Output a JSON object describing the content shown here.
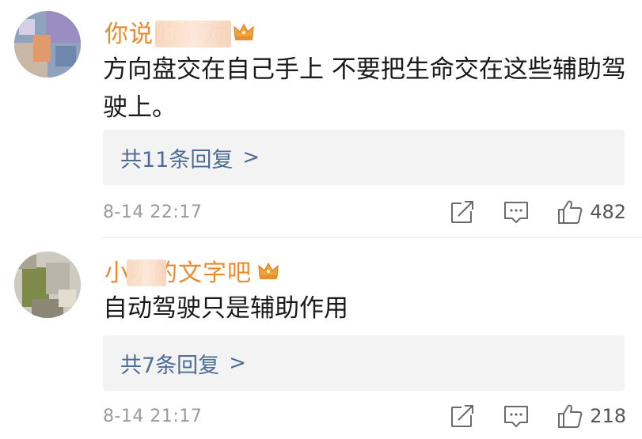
{
  "comments": [
    {
      "username": "你说的都对",
      "content": "方向盘交在自己手上  不要把生命交在这些辅助驾驶上。",
      "reply_link": "共11条回复",
      "reply_chevron": ">",
      "timestamp": "8-14 22:17",
      "like_count": "482"
    },
    {
      "username": "小明的文字吧",
      "content": "自动驾驶只是辅助作用",
      "reply_link": "共7条回复",
      "reply_chevron": ">",
      "timestamp": "8-14 21:17",
      "like_count": "218"
    }
  ],
  "icons": {
    "share": "share-icon",
    "comment": "comment-icon",
    "like": "thumbs-up-icon",
    "badge": "crown-icon"
  },
  "colors": {
    "username": "#ea8a2c",
    "reply_link": "#4e6c95",
    "reply_bg": "#f3f3f3",
    "timestamp": "#9a9a9a",
    "crown": "#f0a23a"
  }
}
